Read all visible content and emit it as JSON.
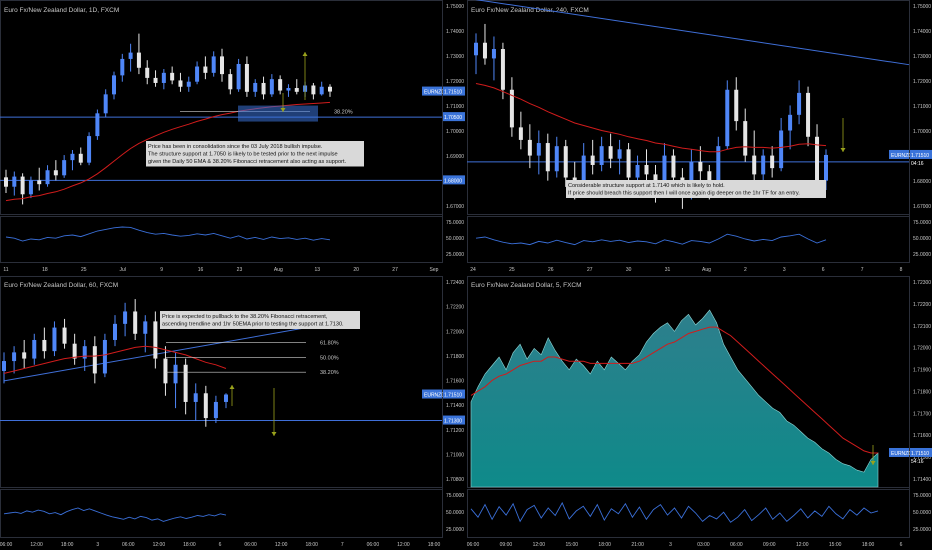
{
  "colors": {
    "background": "#000000",
    "border": "#2a2e39",
    "axis_text": "#c8c8c8",
    "bull": "#4f86f7",
    "bear": "#e6e6e6",
    "ema": "#d11c1c",
    "line": "#3f6fd8",
    "area_top": "#2e7f8c",
    "area_bottom": "#0e8a8a",
    "osc": "#3a6fd8",
    "label_bg": "#3a73d9",
    "note_bg": "#d9d9d9",
    "note_text": "#111111",
    "arrow_up": "#9aa21c",
    "arrow_down": "#9aa21c"
  },
  "chart_data": [
    {
      "type": "candlestick",
      "title": "Euro Fx/New Zealand Dollar, 1D, FXCM",
      "x_ticks": [
        "11",
        "18",
        "25",
        "Jul",
        "9",
        "16",
        "23",
        "Aug",
        "13",
        "20",
        "27",
        "Sep"
      ],
      "y_ticks": [
        "1.75000",
        "1.74000",
        "1.73000",
        "1.72000",
        "1.71000",
        "1.70000",
        "1.69000",
        "1.68000",
        "1.67000"
      ],
      "ylim": [
        1.6675,
        1.7505
      ],
      "price_label": "EURNZD",
      "price_value": "1.71510",
      "level_label": "1.70500",
      "support_label": "1.68000",
      "fib_label": "38.20%",
      "support_levels": [
        1.705,
        1.68
      ],
      "fib_level": 1.7072,
      "note": [
        "Price has been in consolidation since the 03 July 2018 bullish impulse.",
        "The structure support at 1.7050 is likely to be tested prior to the next impulse",
        "given the Daily 50 EMA & 38.20% Fibonacci retracement also acting as support."
      ],
      "osc_ticks": [
        "75.0000",
        "50.0000",
        "25.0000"
      ],
      "candles": [
        [
          1.6812,
          1.6842,
          1.675,
          1.6775
        ],
        [
          1.6775,
          1.6835,
          1.674,
          1.6815
        ],
        [
          1.6815,
          1.6828,
          1.6705,
          1.6745
        ],
        [
          1.6745,
          1.6815,
          1.673,
          1.68
        ],
        [
          1.68,
          1.685,
          1.676,
          1.6785
        ],
        [
          1.6785,
          1.686,
          1.6775,
          1.684
        ],
        [
          1.684,
          1.688,
          1.68,
          1.682
        ],
        [
          1.682,
          1.69,
          1.681,
          1.688
        ],
        [
          1.688,
          1.692,
          1.684,
          1.6905
        ],
        [
          1.6905,
          1.693,
          1.686,
          1.687
        ],
        [
          1.687,
          1.699,
          1.686,
          1.6975
        ],
        [
          1.6975,
          1.708,
          1.696,
          1.7065
        ],
        [
          1.7065,
          1.716,
          1.705,
          1.714
        ],
        [
          1.714,
          1.723,
          1.712,
          1.7215
        ],
        [
          1.7215,
          1.73,
          1.719,
          1.728
        ],
        [
          1.728,
          1.734,
          1.723,
          1.7305
        ],
        [
          1.7305,
          1.738,
          1.722,
          1.7245
        ],
        [
          1.7245,
          1.7275,
          1.718,
          1.7205
        ],
        [
          1.7205,
          1.7235,
          1.717,
          1.7185
        ],
        [
          1.7185,
          1.724,
          1.716,
          1.7225
        ],
        [
          1.7225,
          1.725,
          1.718,
          1.7195
        ],
        [
          1.7195,
          1.7225,
          1.715,
          1.717
        ],
        [
          1.717,
          1.721,
          1.715,
          1.719
        ],
        [
          1.719,
          1.727,
          1.718,
          1.725
        ],
        [
          1.725,
          1.729,
          1.72,
          1.7225
        ],
        [
          1.7225,
          1.731,
          1.721,
          1.729
        ],
        [
          1.729,
          1.732,
          1.719,
          1.722
        ],
        [
          1.722,
          1.724,
          1.714,
          1.716
        ],
        [
          1.716,
          1.728,
          1.715,
          1.726
        ],
        [
          1.726,
          1.729,
          1.713,
          1.715
        ],
        [
          1.715,
          1.72,
          1.713,
          1.7185
        ],
        [
          1.7185,
          1.721,
          1.712,
          1.714
        ],
        [
          1.714,
          1.722,
          1.713,
          1.72
        ],
        [
          1.72,
          1.7215,
          1.714,
          1.7155
        ],
        [
          1.7155,
          1.718,
          1.713,
          1.7165
        ],
        [
          1.7165,
          1.72,
          1.714,
          1.715
        ],
        [
          1.715,
          1.719,
          1.713,
          1.7175
        ],
        [
          1.7175,
          1.7185,
          1.712,
          1.714
        ],
        [
          1.714,
          1.719,
          1.7135,
          1.717
        ],
        [
          1.717,
          1.718,
          1.713,
          1.7151
        ]
      ],
      "ema": [
        1.672,
        1.6725,
        1.6728,
        1.6735,
        1.674,
        1.6748,
        1.6755,
        1.6765,
        1.6778,
        1.679,
        1.6806,
        1.6826,
        1.685,
        1.6876,
        1.6902,
        1.6926,
        1.6946,
        1.6962,
        1.6976,
        1.699,
        1.7002,
        1.7012,
        1.7022,
        1.7033,
        1.7042,
        1.7052,
        1.706,
        1.7066,
        1.7073,
        1.7078,
        1.7083,
        1.7087,
        1.7091,
        1.7094,
        1.7097,
        1.71,
        1.7102,
        1.7104,
        1.7106,
        1.7108
      ],
      "osc": [
        55,
        52,
        45,
        50,
        48,
        54,
        52,
        58,
        60,
        56,
        63,
        70,
        74,
        78,
        80,
        79,
        72,
        66,
        62,
        64,
        60,
        57,
        59,
        63,
        60,
        64,
        58,
        52,
        58,
        50,
        54,
        49,
        55,
        51,
        53,
        49,
        52,
        47,
        51,
        48
      ]
    },
    {
      "type": "candlestick",
      "title": "Euro Fx/New Zealand Dollar, 240, FXCM",
      "x_ticks": [
        "24",
        "25",
        "26",
        "27",
        "30",
        "31",
        "Aug",
        "2",
        "3",
        "6",
        "7",
        "8"
      ],
      "y_ticks": [
        "1.75000",
        "1.74000",
        "1.73000",
        "1.72000",
        "1.71000",
        "1.70000",
        "1.69000",
        "1.68000",
        "1.67000"
      ],
      "ylim": [
        1.706,
        1.7395
      ],
      "price_label": "EURNZD",
      "price_value": "1.71510",
      "countdown": "04:16",
      "support_level": 1.714,
      "note": [
        "Considerable structure support at 1.7140 which is likely to hold.",
        "If price should breach this support then I will once again dig deeper on the 1hr TF for an entry."
      ],
      "osc_ticks": [
        "75.0000",
        "50.0000",
        "25.0000"
      ],
      "candles": [
        [
          1.731,
          1.7345,
          1.728,
          1.733
        ],
        [
          1.733,
          1.736,
          1.7295,
          1.7305
        ],
        [
          1.7305,
          1.734,
          1.727,
          1.732
        ],
        [
          1.732,
          1.733,
          1.724,
          1.7255
        ],
        [
          1.7255,
          1.7275,
          1.718,
          1.7195
        ],
        [
          1.7195,
          1.722,
          1.716,
          1.7175
        ],
        [
          1.7175,
          1.72,
          1.713,
          1.715
        ],
        [
          1.715,
          1.719,
          1.712,
          1.717
        ],
        [
          1.717,
          1.7185,
          1.711,
          1.7125
        ],
        [
          1.7125,
          1.718,
          1.7115,
          1.7165
        ],
        [
          1.7165,
          1.7175,
          1.71,
          1.7115
        ],
        [
          1.7115,
          1.714,
          1.708,
          1.71
        ],
        [
          1.71,
          1.717,
          1.7095,
          1.715
        ],
        [
          1.715,
          1.7175,
          1.712,
          1.7135
        ],
        [
          1.7135,
          1.718,
          1.7125,
          1.7165
        ],
        [
          1.7165,
          1.7185,
          1.713,
          1.7145
        ],
        [
          1.7145,
          1.7175,
          1.712,
          1.716
        ],
        [
          1.716,
          1.717,
          1.7105,
          1.7115
        ],
        [
          1.7115,
          1.715,
          1.709,
          1.7135
        ],
        [
          1.7135,
          1.716,
          1.71,
          1.712
        ],
        [
          1.712,
          1.7135,
          1.7075,
          1.709
        ],
        [
          1.709,
          1.717,
          1.7085,
          1.715
        ],
        [
          1.715,
          1.716,
          1.71,
          1.7115
        ],
        [
          1.7115,
          1.713,
          1.7065,
          1.7085
        ],
        [
          1.7085,
          1.716,
          1.708,
          1.714
        ],
        [
          1.714,
          1.7165,
          1.711,
          1.7125
        ],
        [
          1.7125,
          1.7135,
          1.708,
          1.7095
        ],
        [
          1.7095,
          1.718,
          1.709,
          1.7165
        ],
        [
          1.7165,
          1.727,
          1.716,
          1.7255
        ],
        [
          1.7255,
          1.7275,
          1.719,
          1.7205
        ],
        [
          1.7205,
          1.7225,
          1.714,
          1.715
        ],
        [
          1.715,
          1.719,
          1.71,
          1.712
        ],
        [
          1.712,
          1.716,
          1.711,
          1.715
        ],
        [
          1.715,
          1.7165,
          1.7115,
          1.713
        ],
        [
          1.713,
          1.721,
          1.7125,
          1.719
        ],
        [
          1.719,
          1.723,
          1.716,
          1.7215
        ],
        [
          1.7215,
          1.727,
          1.72,
          1.725
        ],
        [
          1.725,
          1.726,
          1.7165,
          1.718
        ],
        [
          1.718,
          1.72,
          1.71,
          1.711
        ],
        [
          1.711,
          1.716,
          1.7095,
          1.7151
        ]
      ],
      "ema": [
        1.7265,
        1.7262,
        1.7258,
        1.7252,
        1.7246,
        1.724,
        1.7233,
        1.7227,
        1.722,
        1.7214,
        1.7208,
        1.7202,
        1.7198,
        1.7194,
        1.719,
        1.7187,
        1.7184,
        1.718,
        1.7177,
        1.7174,
        1.717,
        1.7168,
        1.7165,
        1.7162,
        1.716,
        1.7158,
        1.7156,
        1.7156,
        1.716,
        1.7163,
        1.7164,
        1.7163,
        1.7163,
        1.7162,
        1.7163,
        1.7165,
        1.7168,
        1.7169,
        1.7167,
        1.7166
      ],
      "trend_start": 1.74,
      "trend_end": 1.7295,
      "osc": [
        52,
        55,
        48,
        42,
        38,
        40,
        36,
        44,
        40,
        47,
        41,
        36,
        46,
        43,
        48,
        44,
        47,
        41,
        45,
        43,
        38,
        48,
        43,
        37,
        46,
        44,
        40,
        50,
        62,
        57,
        50,
        45,
        49,
        46,
        55,
        58,
        62,
        50,
        40,
        48
      ]
    },
    {
      "type": "candlestick",
      "title": "Euro Fx/New Zealand Dollar, 60, FXCM",
      "x_ticks": [
        "06:00",
        "12:00",
        "18:00",
        "3",
        "06:00",
        "12:00",
        "18:00",
        "6",
        "06:00",
        "12:00",
        "18:00",
        "7",
        "06:00",
        "12:00",
        "18:00"
      ],
      "y_ticks": [
        "1.72400",
        "1.72200",
        "1.72000",
        "1.71800",
        "1.71600",
        "1.71400",
        "1.71200",
        "1.71000",
        "1.70800"
      ],
      "ylim": [
        1.7078,
        1.7245
      ],
      "price_label": "EURNZD",
      "price_value": "1.71510",
      "support_label": "1.71300",
      "support_level": 1.713,
      "fib_levels": [
        {
          "label": "61.80%",
          "value": 1.7193
        },
        {
          "label": "50.00%",
          "value": 1.7181
        },
        {
          "label": "38.20%",
          "value": 1.7169
        }
      ],
      "note": [
        "Price is expected to pullback to the 38.20% Fibonacci retracement,",
        "ascending trendline and 1hr 50EMA prior to testing the support at 1.7130."
      ],
      "osc_ticks": [
        "75.0000",
        "50.0000",
        "25.0000"
      ],
      "candles": [
        [
          1.717,
          1.7185,
          1.716,
          1.7178
        ],
        [
          1.7178,
          1.719,
          1.7168,
          1.7185
        ],
        [
          1.7185,
          1.7195,
          1.7172,
          1.718
        ],
        [
          1.718,
          1.72,
          1.7175,
          1.7195
        ],
        [
          1.7195,
          1.7205,
          1.718,
          1.7186
        ],
        [
          1.7186,
          1.721,
          1.7182,
          1.7205
        ],
        [
          1.7205,
          1.7212,
          1.7188,
          1.7192
        ],
        [
          1.7192,
          1.72,
          1.7175,
          1.718
        ],
        [
          1.718,
          1.7195,
          1.717,
          1.719
        ],
        [
          1.719,
          1.7198,
          1.716,
          1.7168
        ],
        [
          1.7168,
          1.72,
          1.7165,
          1.7195
        ],
        [
          1.7195,
          1.7215,
          1.719,
          1.7208
        ],
        [
          1.7208,
          1.7225,
          1.7198,
          1.7218
        ],
        [
          1.7218,
          1.7228,
          1.7195,
          1.72
        ],
        [
          1.72,
          1.7215,
          1.7185,
          1.721
        ],
        [
          1.721,
          1.7218,
          1.7172,
          1.718
        ],
        [
          1.718,
          1.719,
          1.715,
          1.716
        ],
        [
          1.716,
          1.7185,
          1.714,
          1.7175
        ],
        [
          1.7175,
          1.718,
          1.7135,
          1.7145
        ],
        [
          1.7145,
          1.716,
          1.713,
          1.7152
        ],
        [
          1.7152,
          1.7158,
          1.7125,
          1.7132
        ],
        [
          1.7132,
          1.715,
          1.7128,
          1.7145
        ],
        [
          1.7145,
          1.7152,
          1.714,
          1.7151
        ]
      ],
      "ema": [
        1.7168,
        1.717,
        1.7172,
        1.7174,
        1.7176,
        1.7178,
        1.718,
        1.7181,
        1.7182,
        1.7182,
        1.7183,
        1.7185,
        1.7187,
        1.7189,
        1.719,
        1.7189,
        1.7187,
        1.7185,
        1.7183,
        1.718,
        1.7177,
        1.7175,
        1.7172
      ],
      "trend_start": 1.7162,
      "trend_end": 1.721,
      "osc": [
        48,
        50,
        52,
        49,
        55,
        52,
        57,
        54,
        48,
        51,
        46,
        53,
        58,
        62,
        56,
        60,
        55,
        50,
        45,
        41,
        38,
        35,
        40,
        36,
        42,
        39,
        33,
        36,
        30,
        34,
        38,
        41,
        37,
        40,
        44,
        42,
        46,
        43,
        48,
        45
      ]
    },
    {
      "type": "area",
      "title": "Euro Fx/New Zealand Dollar, 5, FXCM",
      "x_ticks": [
        "06:00",
        "09:00",
        "12:00",
        "15:00",
        "18:00",
        "21:00",
        "3",
        "03:00",
        "06:00",
        "09:00",
        "12:00",
        "15:00",
        "18:00",
        "6"
      ],
      "y_ticks": [
        "1.72300",
        "1.72200",
        "1.72100",
        "1.72000",
        "1.71900",
        "1.71800",
        "1.71700",
        "1.71600",
        "1.71500",
        "1.71400"
      ],
      "ylim": [
        1.7136,
        1.7233
      ],
      "price_label": "EURNZD",
      "price_value": "1.71510",
      "countdown": "54:16",
      "values": [
        1.7175,
        1.7182,
        1.7188,
        1.7192,
        1.7196,
        1.719,
        1.7198,
        1.7202,
        1.7195,
        1.72,
        1.7197,
        1.7205,
        1.7199,
        1.7194,
        1.719,
        1.7195,
        1.7192,
        1.7188,
        1.7194,
        1.719,
        1.7196,
        1.7193,
        1.719,
        1.7194,
        1.7197,
        1.7203,
        1.7207,
        1.721,
        1.7212,
        1.7208,
        1.7213,
        1.7216,
        1.7211,
        1.7214,
        1.7218,
        1.7212,
        1.7202,
        1.7196,
        1.719,
        1.7186,
        1.7182,
        1.7178,
        1.7175,
        1.7172,
        1.717,
        1.7166,
        1.7164,
        1.7161,
        1.7158,
        1.7156,
        1.7153,
        1.7151,
        1.7148,
        1.7146,
        1.7145,
        1.7143,
        1.7142,
        1.7148,
        1.7151
      ],
      "ema": [
        1.7178,
        1.718,
        1.7182,
        1.7185,
        1.7187,
        1.7188,
        1.719,
        1.7192,
        1.7193,
        1.7194,
        1.7194,
        1.7196,
        1.7196,
        1.7195,
        1.7194,
        1.7194,
        1.7194,
        1.7193,
        1.7193,
        1.7193,
        1.7193,
        1.7193,
        1.7193,
        1.7193,
        1.7194,
        1.7196,
        1.7198,
        1.72,
        1.7202,
        1.7203,
        1.7205,
        1.7207,
        1.7208,
        1.7209,
        1.721,
        1.721,
        1.7208,
        1.7206,
        1.7203,
        1.72,
        1.7197,
        1.7194,
        1.7191,
        1.7188,
        1.7185,
        1.7182,
        1.7179,
        1.7176,
        1.7173,
        1.717,
        1.7167,
        1.7164,
        1.7161,
        1.7158,
        1.7156,
        1.7154,
        1.7152,
        1.7151,
        1.7151
      ],
      "osc_ticks": [
        "75.0000",
        "50.0000",
        "25.0000"
      ],
      "osc": [
        60,
        40,
        70,
        35,
        65,
        45,
        72,
        30,
        58,
        68,
        38,
        62,
        44,
        74,
        36,
        55,
        66,
        42,
        70,
        33,
        60,
        48,
        72,
        40,
        64,
        35,
        58,
        70,
        45,
        62,
        38,
        66,
        50,
        30,
        44,
        36,
        52,
        28,
        40,
        58,
        32,
        46,
        62,
        35,
        50,
        30,
        44,
        60,
        38,
        55,
        42,
        66,
        48,
        36,
        58,
        45,
        62,
        50,
        55
      ]
    }
  ]
}
